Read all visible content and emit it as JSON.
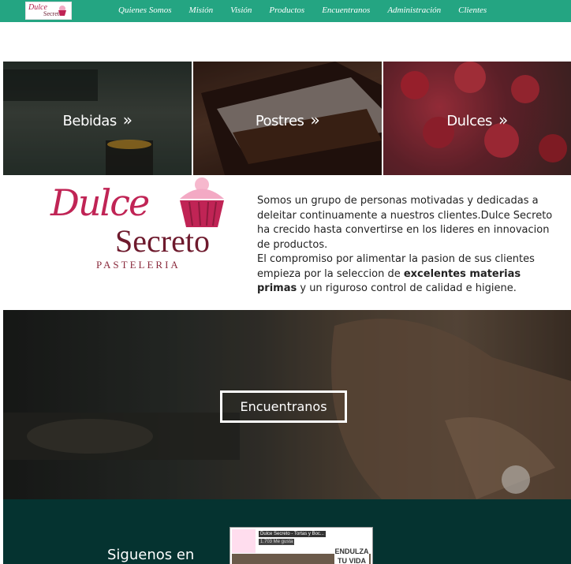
{
  "nav": {
    "logo_line1": "Dulce",
    "logo_line2": "Secreto",
    "items": [
      "Quienes Somos",
      "Misión",
      "Visión",
      "Productos",
      "Encuentranos",
      "Administración",
      "Clientes"
    ]
  },
  "products": [
    {
      "label": "Bebidas",
      "chevron": "»"
    },
    {
      "label": "Postres",
      "chevron": "»"
    },
    {
      "label": "Dulces",
      "chevron": "»"
    }
  ],
  "about": {
    "logo_dulce": "Dulce",
    "logo_secreto": "Secreto",
    "logo_pasteleria": "PASTELERIA",
    "para1": "Somos un grupo de personas motivadas y dedicadas a deleitar continuamente a nuestros clientes.Dulce Secreto ha crecido hasta convertirse en los lideres en innovacion de productos.",
    "para2_start": "El compromiso por alimentar la pasion de sus clientes empieza por la seleccion de ",
    "para2_bold": "excelentes materias primas",
    "para2_end": " y un riguroso control de calidad e higiene."
  },
  "hero": {
    "button": "Encuentranos"
  },
  "footer": {
    "follow": "Siguenos en",
    "fb_title": "Dulce Secreto - Tortas y Boc...",
    "fb_likes": "1.703 Me gusta",
    "fb_banner": "ENDULZA TU VIDA"
  },
  "colors": {
    "nav_bg": "#24a582",
    "footer_bg": "#053330",
    "brand": "#c02455"
  }
}
